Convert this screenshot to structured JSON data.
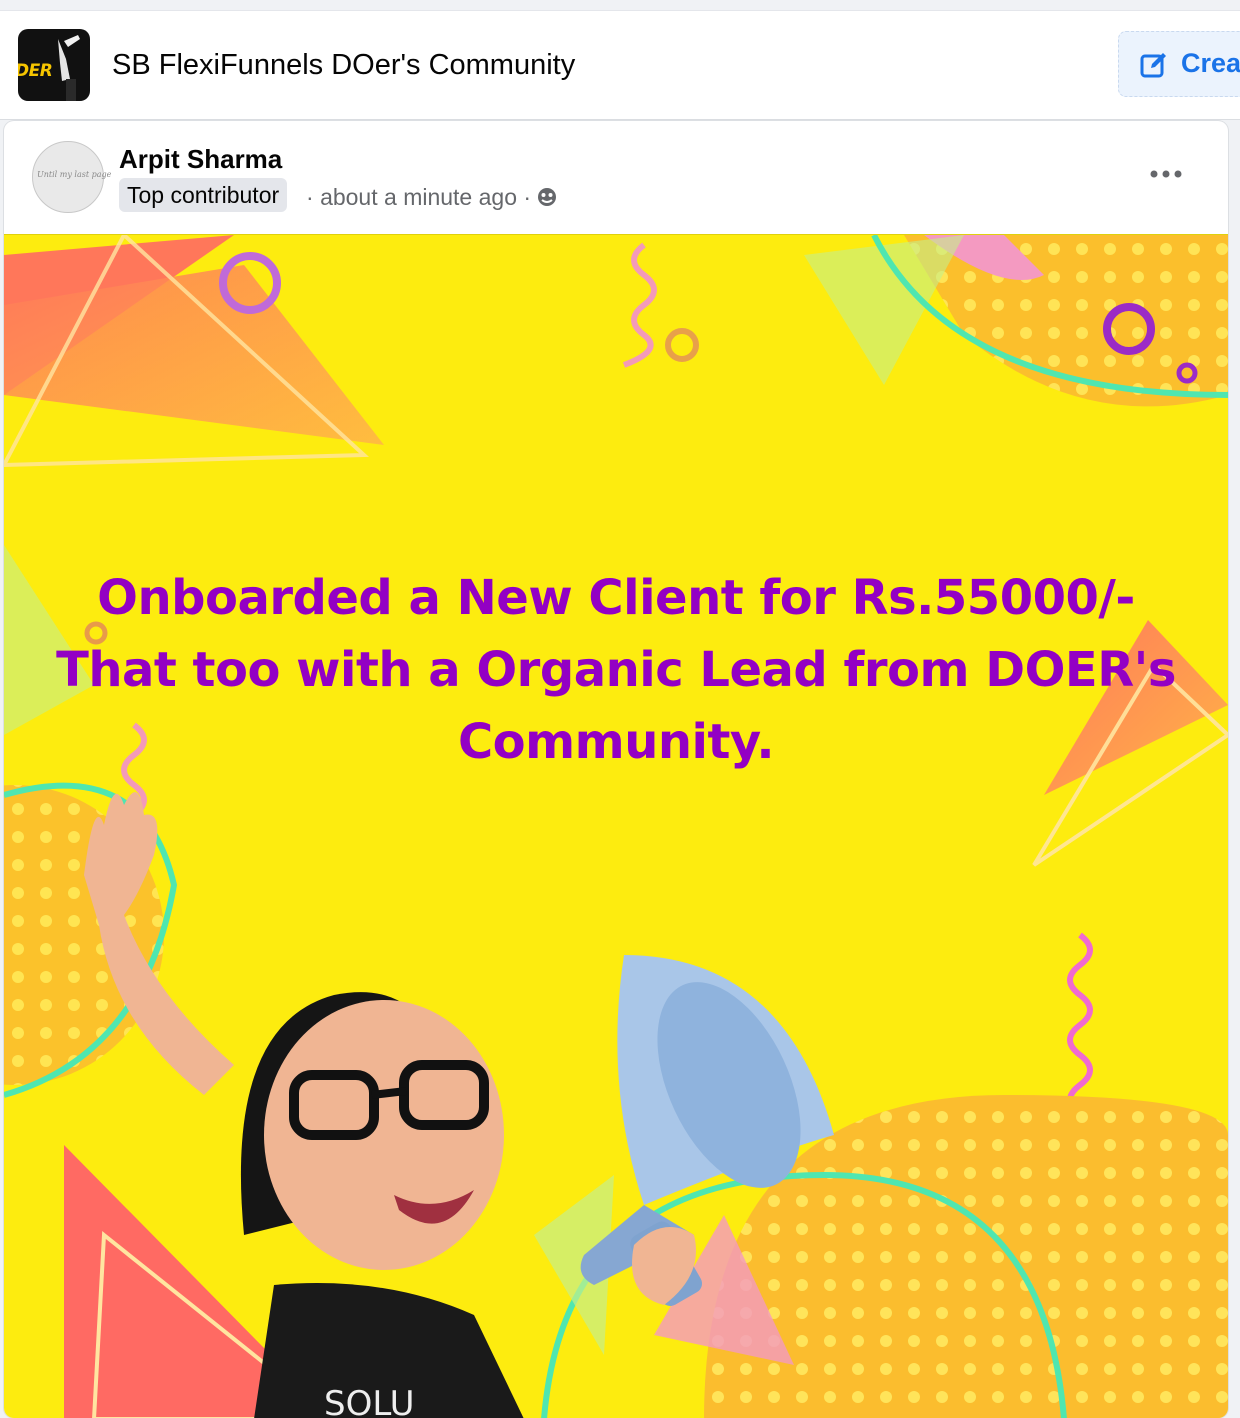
{
  "group": {
    "logo_text": "DER",
    "title": "SB FlexiFunnels DOer's Community",
    "create_label": "Crea"
  },
  "post": {
    "author": "Arpit Sharma",
    "avatar_scribble": "Until my last page",
    "badge": "Top contributor",
    "time": "about a minute ago",
    "separator": "·",
    "headline_lines": [
      "Onboarded a New Client for Rs.55000/-",
      "That too with a Organic Lead from DOER's",
      "Community."
    ],
    "shirt_text": "SOLU"
  },
  "colors": {
    "accent": "#1a73e8",
    "headline": "#9300c4",
    "background_yellow": "#fdec0f"
  },
  "icons": [
    "create-edit-icon",
    "globe-icon",
    "more-dots-icon"
  ]
}
